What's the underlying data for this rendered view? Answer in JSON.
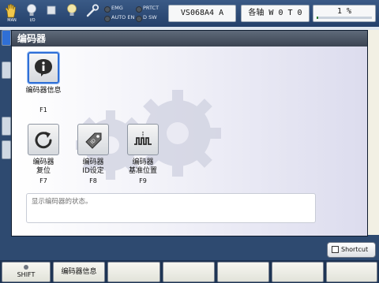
{
  "topbar": {
    "icons": [
      {
        "name": "hand-icon",
        "caption": "MAN"
      },
      {
        "name": "io-bulb-icon",
        "caption": "I/O"
      },
      {
        "name": "stop-square-icon",
        "caption": ""
      },
      {
        "name": "bulb-icon",
        "caption": ""
      },
      {
        "name": "wrench-icon",
        "caption": ""
      }
    ],
    "lamps": [
      "EMG",
      "PRTCT",
      "AUTO EN",
      "D SW"
    ],
    "program_field": "VS068A4 A",
    "axis_field": "各轴  W 0 T 0",
    "override_value": "1 %",
    "override_fraction": 0.01
  },
  "dialog": {
    "title": "编码器",
    "tiles": [
      {
        "label": "编码器信息",
        "fkey": "F1",
        "icon": "info-icon"
      },
      {
        "label": "编码器\n复位",
        "fkey": "F7",
        "icon": "reset-arrow-icon"
      },
      {
        "label": "编码器\nID设定",
        "fkey": "F8",
        "icon": "id-tag-icon"
      },
      {
        "label": "编码器\n基准位置",
        "fkey": "F9",
        "icon": "waveform-icon"
      }
    ],
    "message": "显示编码器的状态。"
  },
  "shortcut": {
    "label": "Shortcut",
    "icon": "shortcut-icon"
  },
  "softkeys": {
    "shift_label": "SHIFT",
    "keys": [
      "编码器信息",
      "",
      "",
      "",
      "",
      ""
    ]
  },
  "colors": {
    "accent_selected": "#2f6fd6",
    "titlebar": "#4a5362",
    "background": "#2e4a70"
  }
}
